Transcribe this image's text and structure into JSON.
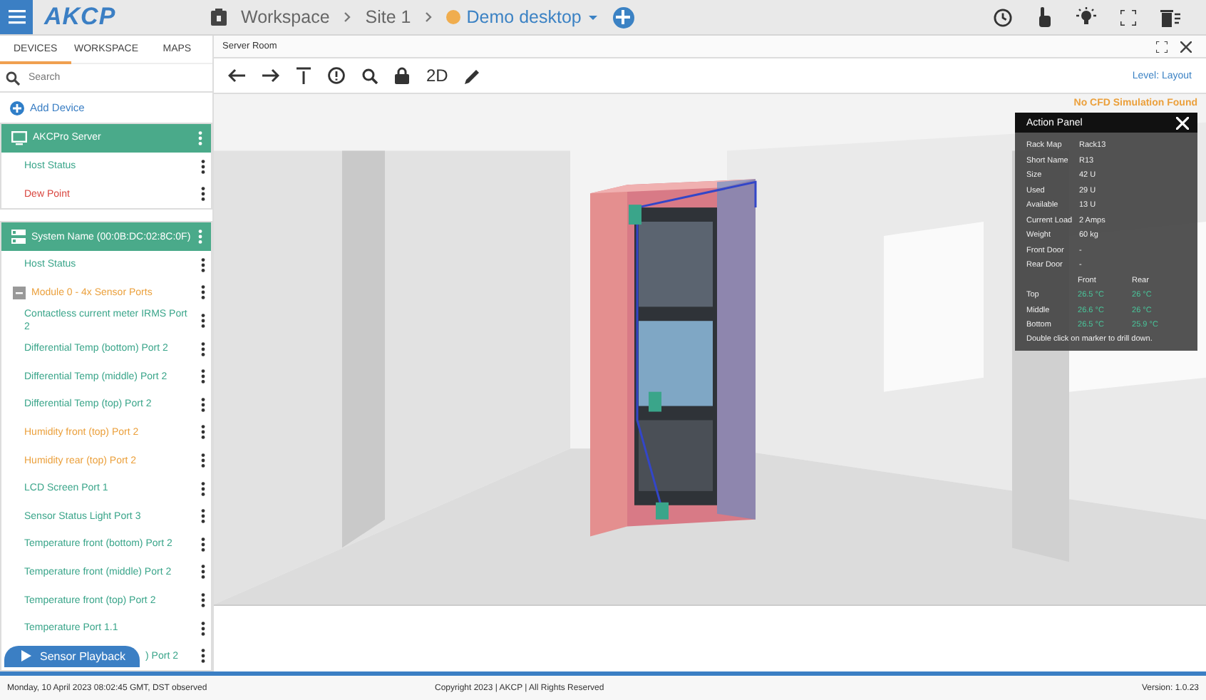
{
  "header": {
    "logo": "AKCP",
    "breadcrumbs": [
      {
        "label": "Workspace",
        "kind": "crumb"
      },
      {
        "label": "Site 1",
        "kind": "crumb"
      },
      {
        "label": "Demo desktop",
        "kind": "current",
        "color": "#f0ad4e"
      }
    ]
  },
  "sidebar": {
    "tabs": [
      {
        "label": "DEVICES",
        "selected": true
      },
      {
        "label": "WORKSPACE",
        "selected": false
      },
      {
        "label": "MAPS",
        "selected": false
      }
    ],
    "search": {
      "placeholder": "Search"
    },
    "add_device": "Add Device",
    "devices": [
      {
        "name": "AKCPro Server",
        "kind": "server",
        "items": [
          {
            "label": "Host Status",
            "color": "#3aa58a",
            "kind": "sensor"
          },
          {
            "label": "Dew Point",
            "color": "#d9463f",
            "kind": "sensor"
          }
        ]
      },
      {
        "name": "System Name (00:0B:DC:02:8C:0F)",
        "kind": "unit",
        "items": [
          {
            "label": "Host Status",
            "color": "#3aa58a",
            "kind": "sensor"
          },
          {
            "label": "Module 0 - 4x Sensor Ports",
            "color": "#eba03c",
            "kind": "module"
          },
          {
            "label": "Contactless current meter IRMS Port 2",
            "color": "#3aa58a",
            "kind": "sensor"
          },
          {
            "label": "Differential Temp (bottom) Port 2",
            "color": "#3aa58a",
            "kind": "sensor"
          },
          {
            "label": "Differential Temp (middle) Port 2",
            "color": "#3aa58a",
            "kind": "sensor"
          },
          {
            "label": "Differential Temp (top) Port 2",
            "color": "#3aa58a",
            "kind": "sensor"
          },
          {
            "label": "Humidity front (top) Port 2",
            "color": "#eba03c",
            "kind": "sensor"
          },
          {
            "label": "Humidity rear (top) Port 2",
            "color": "#eba03c",
            "kind": "sensor"
          },
          {
            "label": "LCD Screen Port 1",
            "color": "#3aa58a",
            "kind": "sensor"
          },
          {
            "label": "Sensor Status Light Port 3",
            "color": "#3aa58a",
            "kind": "sensor"
          },
          {
            "label": "Temperature front (bottom) Port 2",
            "color": "#3aa58a",
            "kind": "sensor"
          },
          {
            "label": "Temperature front (middle) Port 2",
            "color": "#3aa58a",
            "kind": "sensor"
          },
          {
            "label": "Temperature front (top) Port 2",
            "color": "#3aa58a",
            "kind": "sensor"
          },
          {
            "label": "Temperature Port 1.1",
            "color": "#3aa58a",
            "kind": "sensor"
          },
          {
            "label": ") Port 2",
            "color": "#3aa58a",
            "kind": "partial"
          }
        ]
      }
    ],
    "playback": "Sensor Playback"
  },
  "panel": {
    "title": "Server Room",
    "toolbar_label": "2D",
    "level": "Level: Layout",
    "notice": "No CFD Simulation Found",
    "action_panel": {
      "title": "Action Panel",
      "fields": [
        {
          "label": "Rack Map",
          "value": "Rack13"
        },
        {
          "label": "Short Name",
          "value": "R13"
        },
        {
          "label": "Size",
          "value": "42 U"
        },
        {
          "label": "Used",
          "value": "29 U"
        },
        {
          "label": "Available",
          "value": "13 U"
        },
        {
          "label": "Current Load",
          "value": "2 Amps"
        },
        {
          "label": "Weight",
          "value": "60 kg"
        },
        {
          "label": "Front Door",
          "value": "-"
        },
        {
          "label": "Rear Door",
          "value": "-"
        }
      ],
      "columns": [
        "Front",
        "Rear"
      ],
      "temps": [
        {
          "label": "Top",
          "values": [
            "26.5 °C",
            "26 °C"
          ]
        },
        {
          "label": "Middle",
          "values": [
            "26.6 °C",
            "26 °C"
          ]
        },
        {
          "label": "Bottom",
          "values": [
            "26.5 °C",
            "25.9 °C"
          ]
        }
      ],
      "hint": "Double click on marker to drill down."
    }
  },
  "status_bar": {
    "date": "Monday, 10 April 2023 08:02:45 GMT, DST observed",
    "copyright": "Copyright 2023 | AKCP | All Rights Reserved",
    "version": "Version: 1.0.23"
  }
}
